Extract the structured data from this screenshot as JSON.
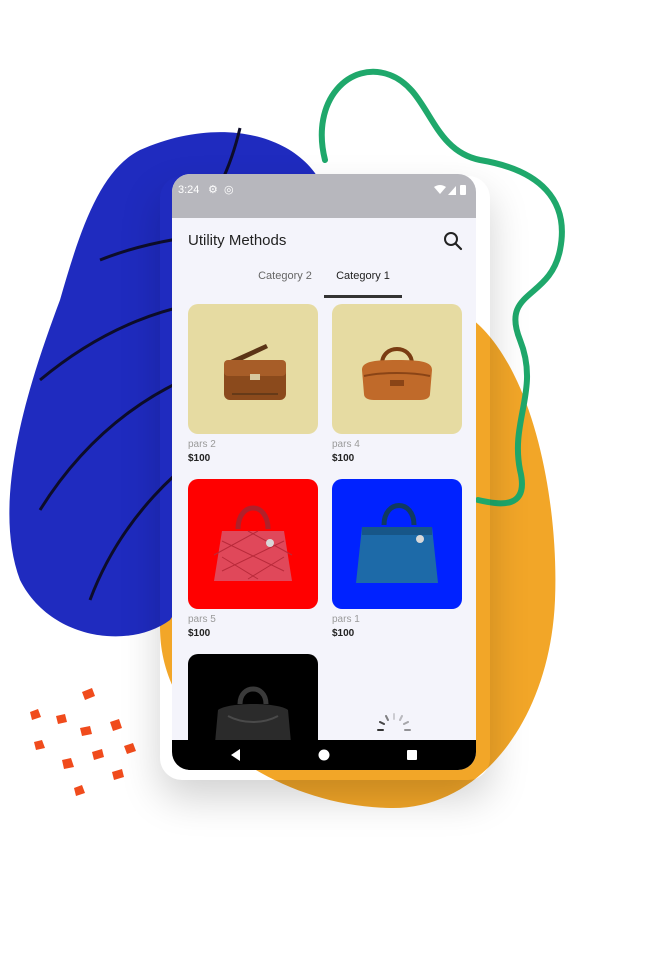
{
  "status_bar": {
    "time": "3:24"
  },
  "app_bar": {
    "title": "Utility Methods"
  },
  "tabs": [
    {
      "label": "Category 2",
      "selected": false
    },
    {
      "label": "Category 1",
      "selected": true
    }
  ],
  "products": [
    {
      "name": "pars 2",
      "price": "$100",
      "bg": "#e6dba2",
      "item": "brown-messenger-bag"
    },
    {
      "name": "pars 4",
      "price": "$100",
      "bg": "#e6dba2",
      "item": "tan-duffel-bag"
    },
    {
      "name": "pars 5",
      "price": "$100",
      "bg": "#ff0000",
      "item": "red-quilted-handbag"
    },
    {
      "name": "pars 1",
      "price": "$100",
      "bg": "#0022ff",
      "item": "blue-tote-handbag"
    },
    {
      "name": "",
      "price": "",
      "bg": "#000000",
      "item": "black-leather-bag"
    }
  ],
  "colors": {
    "blob_blue": "#1f2bbf",
    "blob_orange": "#f2a628",
    "squiggle_green": "#1fa86b",
    "confetti_red": "#f04b1c",
    "status_bar_bg": "#b7b7bd",
    "screen_bg": "#f4f4fb"
  }
}
